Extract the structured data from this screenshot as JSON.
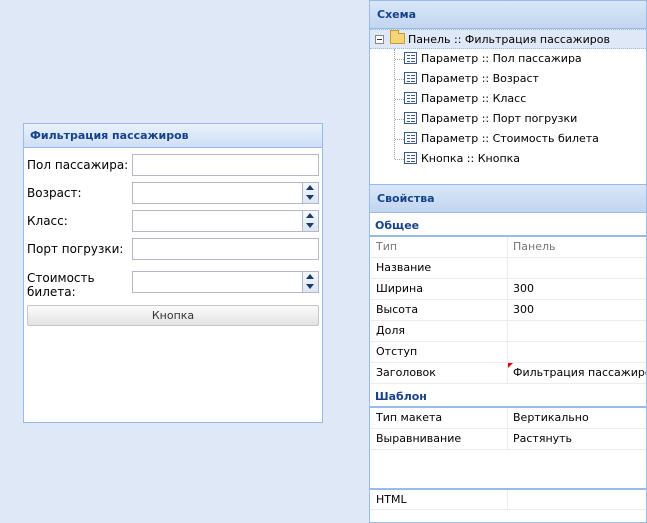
{
  "form_panel": {
    "title": "Фильтрация пассажиров",
    "fields": [
      {
        "label": "Пол пассажира:",
        "type": "text",
        "value": ""
      },
      {
        "label": "Возраст:",
        "type": "number",
        "value": ""
      },
      {
        "label": "Класс:",
        "type": "number",
        "value": ""
      },
      {
        "label": "Порт погрузки:",
        "type": "text",
        "value": ""
      },
      {
        "label": "Стоимость билета:",
        "type": "number",
        "value": ""
      }
    ],
    "button_label": "Кнопка"
  },
  "scheme": {
    "title": "Схема",
    "root": "Панель :: Фильтрация пассажиров",
    "children": [
      "Параметр :: Пол пассажира",
      "Параметр :: Возраст",
      "Параметр :: Класс",
      "Параметр :: Порт погрузки",
      "Параметр :: Стоимость билета",
      "Кнопка :: Кнопка"
    ]
  },
  "properties": {
    "title": "Свойства",
    "general": {
      "title": "Общее",
      "rows": [
        {
          "key": "Тип",
          "value": "Панель"
        },
        {
          "key": "Название",
          "value": ""
        },
        {
          "key": "Ширина",
          "value": "300"
        },
        {
          "key": "Высота",
          "value": "300"
        },
        {
          "key": "Доля",
          "value": ""
        },
        {
          "key": "Отступ",
          "value": ""
        },
        {
          "key": "Заголовок",
          "value": "Фильтрация пассажиров"
        }
      ]
    },
    "template": {
      "title": "Шаблон",
      "rows": [
        {
          "key": "Тип макета",
          "value": "Вертикально"
        },
        {
          "key": "Выравнивание",
          "value": "Растянуть"
        }
      ]
    },
    "html": {
      "key": "HTML",
      "value": ""
    }
  }
}
